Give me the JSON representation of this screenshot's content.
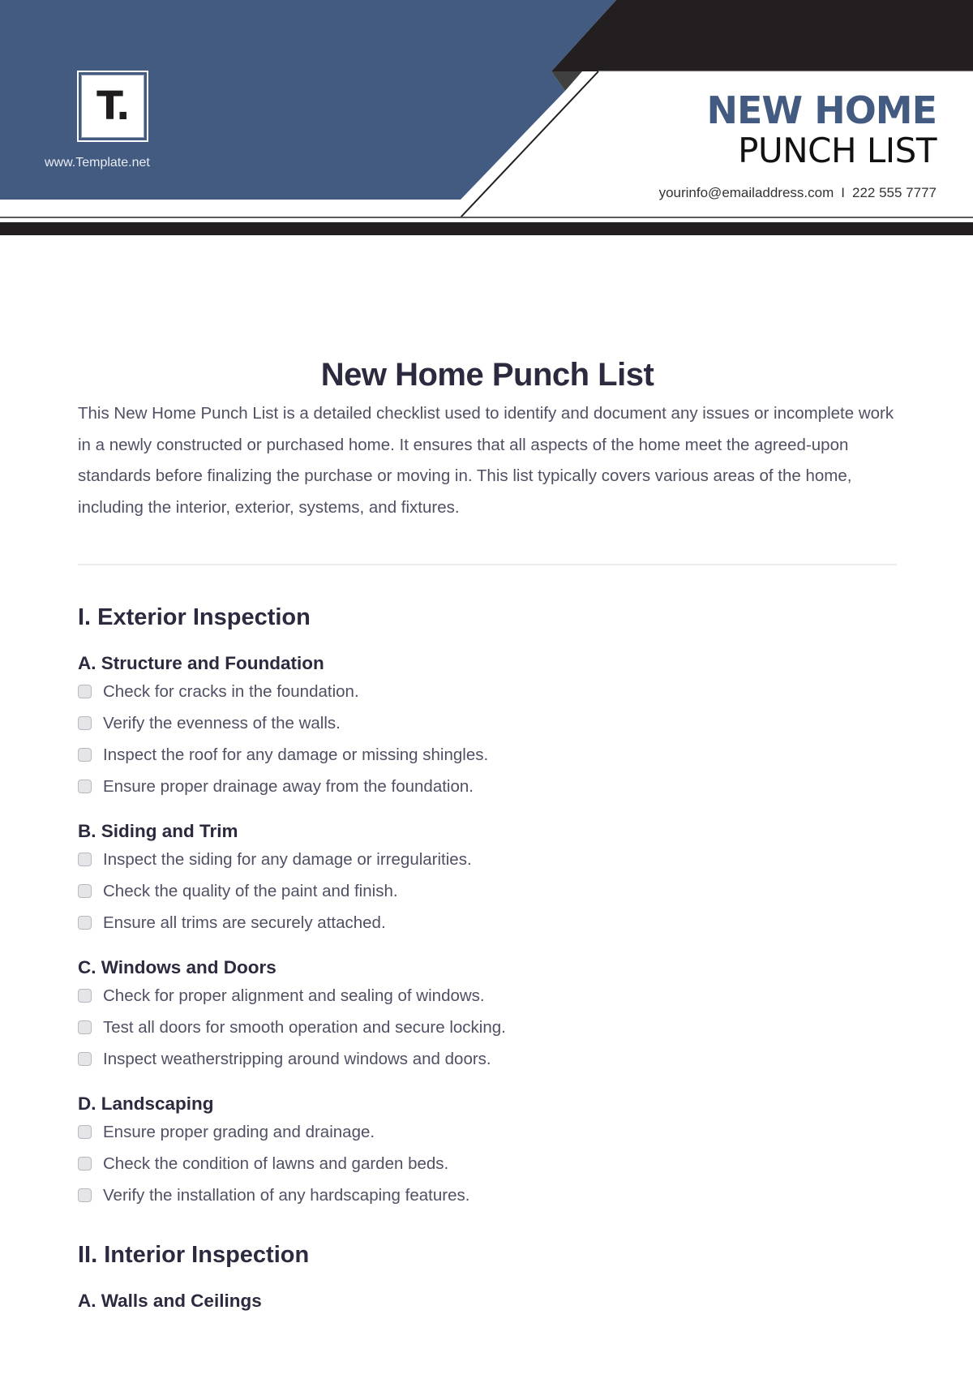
{
  "header": {
    "logo_letter": "T.",
    "website": "www.Template.net",
    "title_line1": "NEW HOME",
    "title_line2": "PUNCH LIST",
    "email": "yourinfo@emailaddress.com",
    "separator": "I",
    "phone": "222 555 7777",
    "colors": {
      "brand_blue": "#435b80",
      "dark": "#231f20"
    }
  },
  "document": {
    "title": "New Home Punch List",
    "intro": "This New Home Punch List is a detailed checklist used to identify and document any issues or incomplete work in a newly constructed or purchased home. It ensures that all aspects of the home meet the agreed-upon standards before finalizing the purchase or moving in. This list typically covers various areas of the home, including the interior, exterior, systems, and fixtures."
  },
  "sections": [
    {
      "title": "I. Exterior Inspection",
      "subsections": [
        {
          "title": "A. Structure and Foundation",
          "items": [
            {
              "label": "Check for cracks in the foundation.",
              "checked": false
            },
            {
              "label": "Verify the evenness of the walls.",
              "checked": false
            },
            {
              "label": "Inspect the roof for any damage or missing shingles.",
              "checked": false
            },
            {
              "label": "Ensure proper drainage away from the foundation.",
              "checked": false
            }
          ]
        },
        {
          "title": "B. Siding and Trim",
          "items": [
            {
              "label": "Inspect the siding for any damage or irregularities.",
              "checked": false
            },
            {
              "label": "Check the quality of the paint and finish.",
              "checked": false
            },
            {
              "label": "Ensure all trims are securely attached.",
              "checked": false
            }
          ]
        },
        {
          "title": "C. Windows and Doors",
          "items": [
            {
              "label": "Check for proper alignment and sealing of windows.",
              "checked": false
            },
            {
              "label": "Test all doors for smooth operation and secure locking.",
              "checked": false
            },
            {
              "label": "Inspect weatherstripping around windows and doors.",
              "checked": false
            }
          ]
        },
        {
          "title": "D. Landscaping",
          "items": [
            {
              "label": "Ensure proper grading and drainage.",
              "checked": false
            },
            {
              "label": "Check the condition of lawns and garden beds.",
              "checked": false
            },
            {
              "label": "Verify the installation of any hardscaping features.",
              "checked": false
            }
          ]
        }
      ]
    },
    {
      "title": "II. Interior Inspection",
      "subsections": [
        {
          "title": "A. Walls and Ceilings",
          "items": []
        }
      ]
    }
  ]
}
